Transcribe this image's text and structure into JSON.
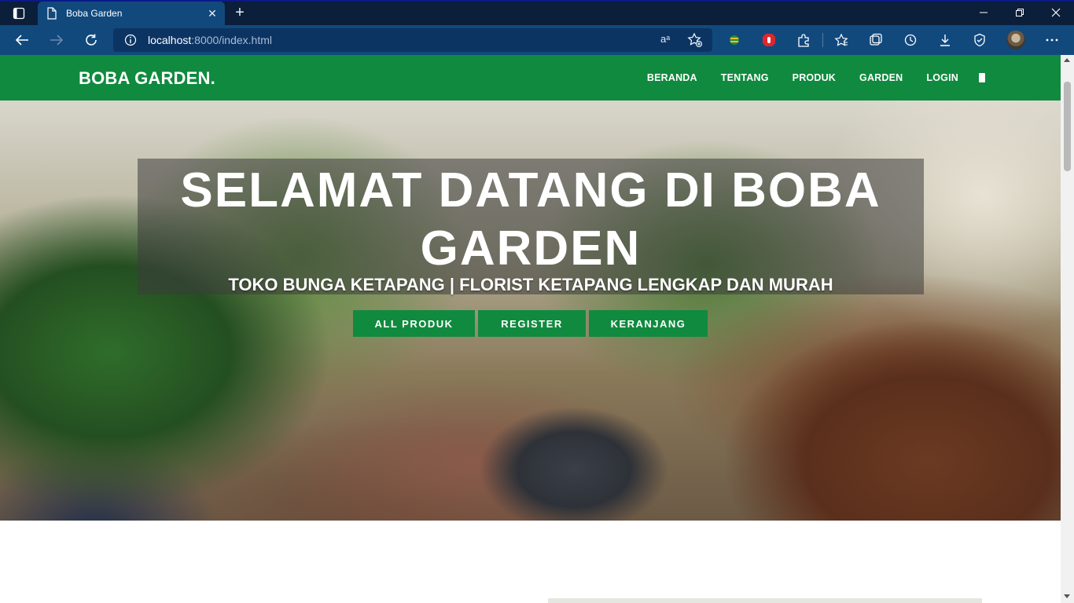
{
  "browser": {
    "tab_title": "Boba Garden",
    "address_host": "localhost",
    "address_path": ":8000/index.html",
    "read_aloud_label": "aᵃ"
  },
  "site": {
    "brand": "BOBA GARDEN.",
    "nav": [
      "BERANDA",
      "TENTANG",
      "PRODUK",
      "GARDEN",
      "LOGIN"
    ],
    "accent_color": "#108a3e"
  },
  "hero": {
    "title": "SELAMAT DATANG DI BOBA GARDEN",
    "subtitle": "TOKO BUNGA KETAPANG | FLORIST KETAPANG LENGKAP DAN MURAH",
    "buttons": [
      "ALL PRODUK",
      "REGISTER",
      "KERANJANG"
    ]
  }
}
